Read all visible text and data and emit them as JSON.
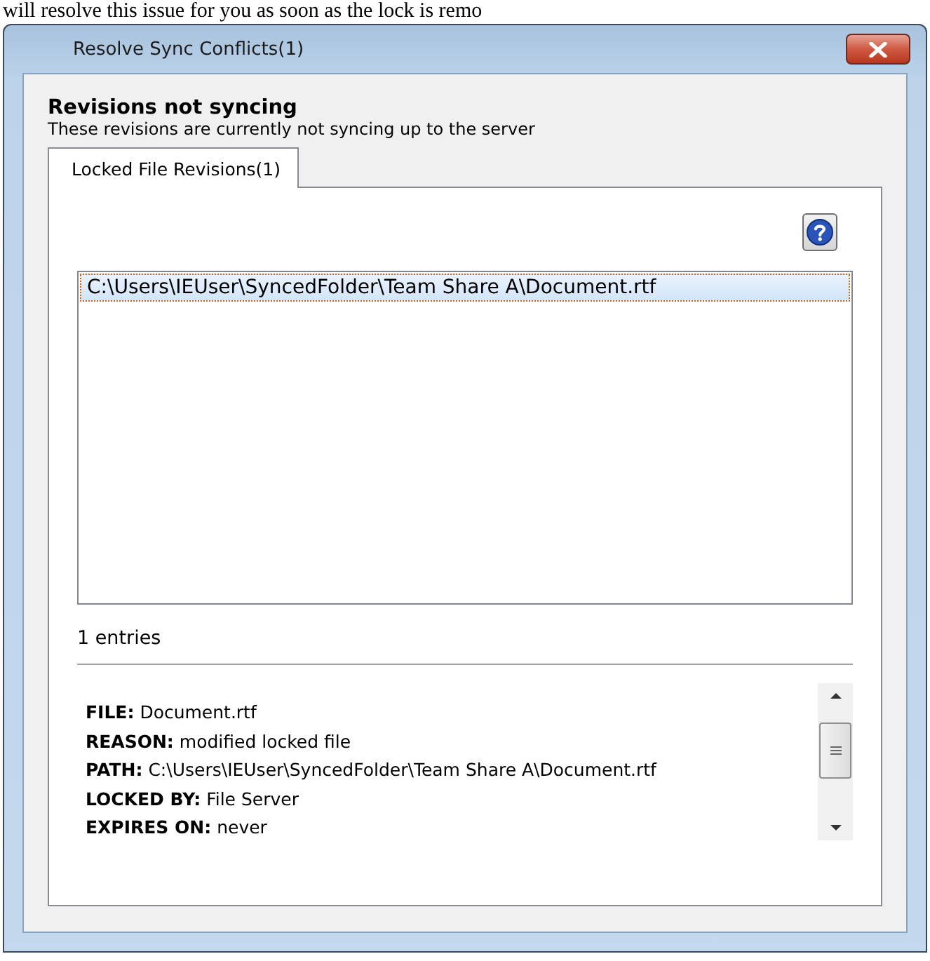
{
  "background_text": "will resolve this issue for you as soon as the lock is remo",
  "window": {
    "title": "Resolve Sync Conflicts(1)"
  },
  "heading": "Revisions not syncing",
  "subheading": "These revisions are currently not syncing up to the server",
  "tabs": [
    {
      "label": "Locked File Revisions(1)",
      "selected": true
    }
  ],
  "list": {
    "rows": [
      {
        "text": "C:\\Users\\IEUser\\SyncedFolder\\Team Share A\\Document.rtf",
        "selected": true
      }
    ],
    "count": "1 entries"
  },
  "details": [
    {
      "label": "FILE:",
      "value": "Document.rtf"
    },
    {
      "label": "REASON:",
      "value": "modified locked file"
    },
    {
      "label": "PATH:",
      "value": "C:\\Users\\IEUser\\SyncedFolder\\Team Share A\\Document.rtf"
    },
    {
      "label": "LOCKED BY:",
      "value": "File Server"
    },
    {
      "label": "EXPIRES ON:",
      "value": "never"
    }
  ]
}
